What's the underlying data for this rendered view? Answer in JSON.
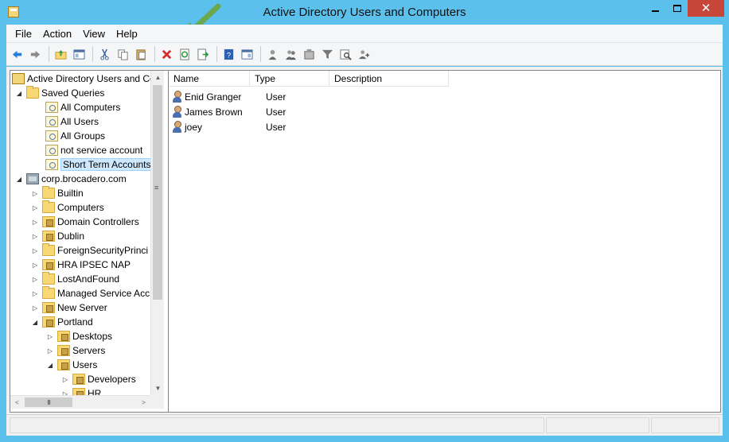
{
  "window": {
    "title": "Active Directory Users and Computers",
    "close_glyph": "✕"
  },
  "menu": [
    "File",
    "Action",
    "View",
    "Help"
  ],
  "toolbar": {
    "buttons": [
      "back-arrow-icon",
      "forward-arrow-icon",
      "up-folder-icon",
      "console-tree-icon",
      "cut-icon",
      "copy-icon",
      "paste-icon",
      "delete-icon",
      "refresh-icon",
      "export-list-icon",
      "help-icon",
      "properties-icon",
      "new-user-icon",
      "new-group-icon",
      "new-ou-icon",
      "filter-icon",
      "find-icon",
      "add-to-group-icon"
    ]
  },
  "tree": {
    "root": "Active Directory Users and Co",
    "saved_queries": "Saved Queries",
    "queries": [
      "All Computers",
      "All Users",
      "All Groups",
      "not service account",
      "Short Term Accounts"
    ],
    "domain": "corp.brocadero.com",
    "domain_children": [
      "Builtin",
      "Computers",
      "Domain Controllers",
      "Dublin",
      "ForeignSecurityPrinci",
      "HRA IPSEC NAP",
      "LostAndFound",
      "Managed Service Acc",
      "New Server",
      "Portland"
    ],
    "portland_children": [
      "Desktops",
      "Servers",
      "Users"
    ],
    "users_children": [
      "Developers",
      "HR"
    ],
    "selected": "Short Term Accounts",
    "expanders": {
      "collapsed": "▷",
      "expanded": "◢"
    },
    "scroll": {
      "up": "▲",
      "down": "▼",
      "left": "<",
      "right": ">",
      "grip": "≡",
      "hgrip": "III"
    }
  },
  "list": {
    "columns": [
      "Name",
      "Type",
      "Description"
    ],
    "rows": [
      {
        "name": "Enid Granger",
        "type": "User"
      },
      {
        "name": "James Brown",
        "type": "User"
      },
      {
        "name": "joey",
        "type": "User"
      }
    ]
  },
  "colors": {
    "frame": "#5bc0eb",
    "selection": "#cde8ff",
    "close_button": "#c7463a",
    "annotation_arrow": "#6aa84f"
  }
}
